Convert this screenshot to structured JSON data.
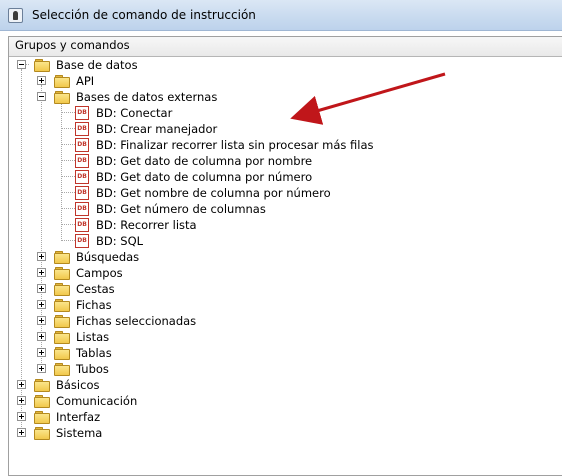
{
  "window": {
    "title": "Selección de comando de instrucción"
  },
  "panel": {
    "header": "Grupos y comandos"
  },
  "tree": {
    "root": {
      "label": "Base de datos",
      "children": {
        "api": "API",
        "externas": {
          "label": "Bases de datos externas",
          "commands": [
            "BD: Conectar",
            "BD: Crear manejador",
            "BD: Finalizar recorrer lista sin procesar más filas",
            "BD: Get dato de columna por nombre",
            "BD: Get dato de columna por número",
            "BD: Get nombre de columna por número",
            "BD: Get número de columnas",
            "BD: Recorrer lista",
            "BD: SQL"
          ],
          "command_icon_text": "DB"
        },
        "others": [
          "Búsquedas",
          "Campos",
          "Cestas",
          "Fichas",
          "Fichas seleccionadas",
          "Listas",
          "Tablas",
          "Tubos"
        ]
      }
    },
    "top_groups": [
      "Básicos",
      "Comunicación",
      "Interfaz",
      "Sistema"
    ]
  },
  "colors": {
    "arrow": "#c0161a",
    "folder": "#f1c84c",
    "db_icon": "#c0352b"
  }
}
